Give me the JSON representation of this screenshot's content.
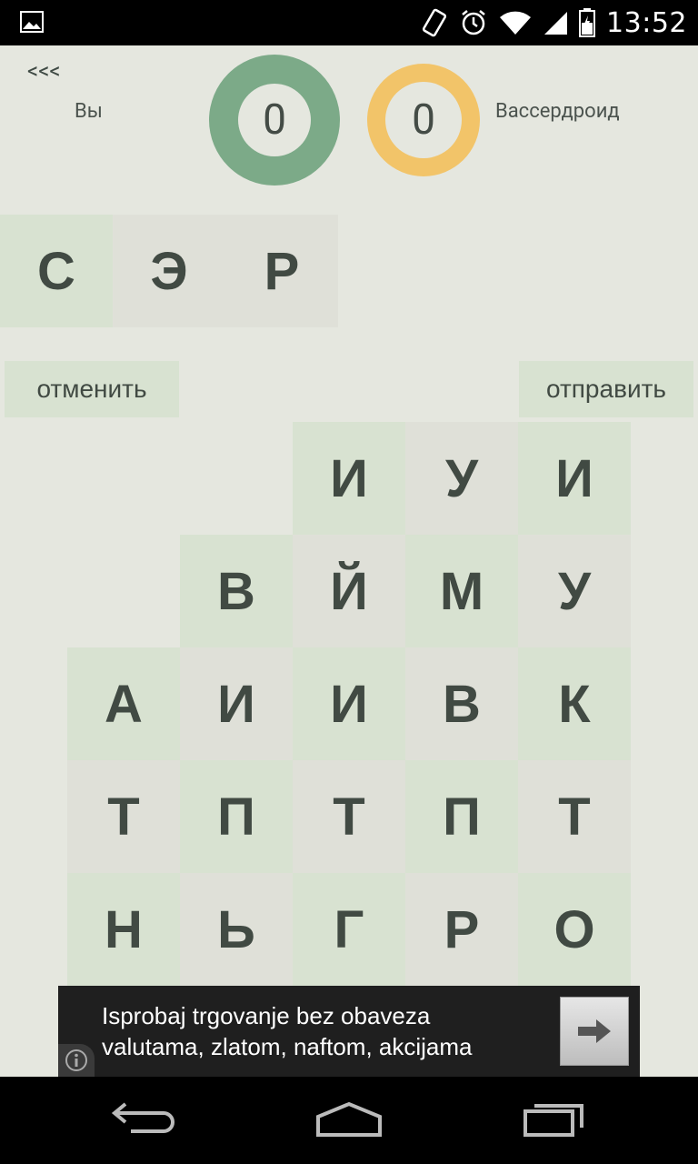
{
  "status_bar": {
    "time": "13:52",
    "icons": [
      "gallery-icon",
      "vibrate-icon",
      "alarm-icon",
      "wifi-icon",
      "signal-icon",
      "battery-icon"
    ]
  },
  "header": {
    "back_label": "<<<",
    "you_label": "Вы",
    "opponent_label": "Вассердроид",
    "you_score": "0",
    "opponent_score": "0",
    "you_color": "#7caa88",
    "opponent_color": "#f2c469"
  },
  "word": {
    "letters": [
      "С",
      "Э",
      "Р"
    ]
  },
  "actions": {
    "cancel_label": "отменить",
    "send_label": "отправить"
  },
  "board": {
    "rows": [
      [
        "",
        "",
        "И",
        "У",
        "И"
      ],
      [
        "",
        "В",
        "Й",
        "М",
        "У"
      ],
      [
        "А",
        "И",
        "И",
        "В",
        "К"
      ],
      [
        "Т",
        "П",
        "Т",
        "П",
        "Т"
      ],
      [
        "Н",
        "Ь",
        "Г",
        "Р",
        "О"
      ]
    ]
  },
  "ad": {
    "line1": "Isprobaj trgovanje bez obaveza",
    "line2": "valutama, zlatom, naftom, akcijama"
  },
  "nav": {
    "icons": [
      "back-icon",
      "home-icon",
      "recent-apps-icon"
    ]
  }
}
